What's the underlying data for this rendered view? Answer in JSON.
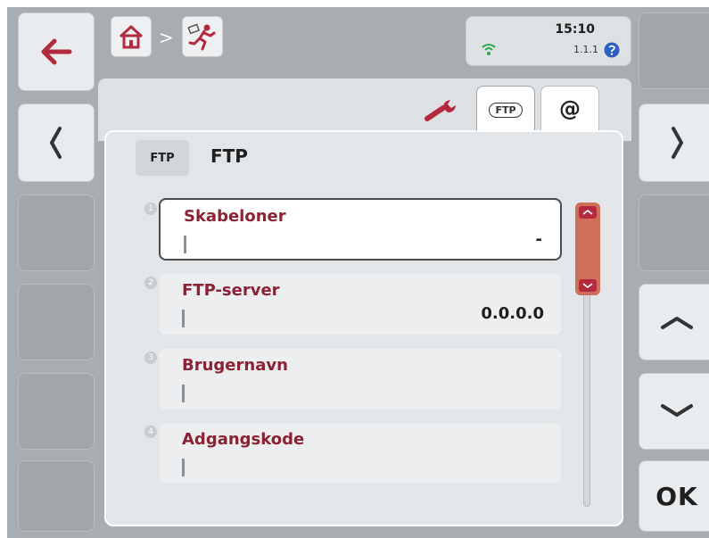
{
  "status": {
    "time": "15:10",
    "version": "1.1.1"
  },
  "breadcrumb": {
    "separator": ">",
    "home_icon": "home-icon",
    "module_icon": "runner-icon"
  },
  "tabs": [
    {
      "name": "settings",
      "icon": "wrench-icon",
      "active": false
    },
    {
      "name": "ftp",
      "label": "FTP",
      "active": true
    },
    {
      "name": "email",
      "label": "@",
      "active": false
    }
  ],
  "header": {
    "badge": "FTP",
    "title": "FTP"
  },
  "fields": [
    {
      "index": "1",
      "label": "Skabeloner",
      "value": "-",
      "selected": true
    },
    {
      "index": "2",
      "label": "FTP-server",
      "value": "0.0.0.0",
      "selected": false
    },
    {
      "index": "3",
      "label": "Brugernavn",
      "value": "",
      "selected": false
    },
    {
      "index": "4",
      "label": "Adgangskode",
      "value": "",
      "selected": false
    }
  ],
  "buttons": {
    "ok": "OK"
  },
  "colors": {
    "accent": "#8b2235",
    "scroll": "#b32a3e",
    "thumb": "#cf6f5a",
    "wifi": "#2aa84a",
    "info": "#2d5fc4"
  }
}
